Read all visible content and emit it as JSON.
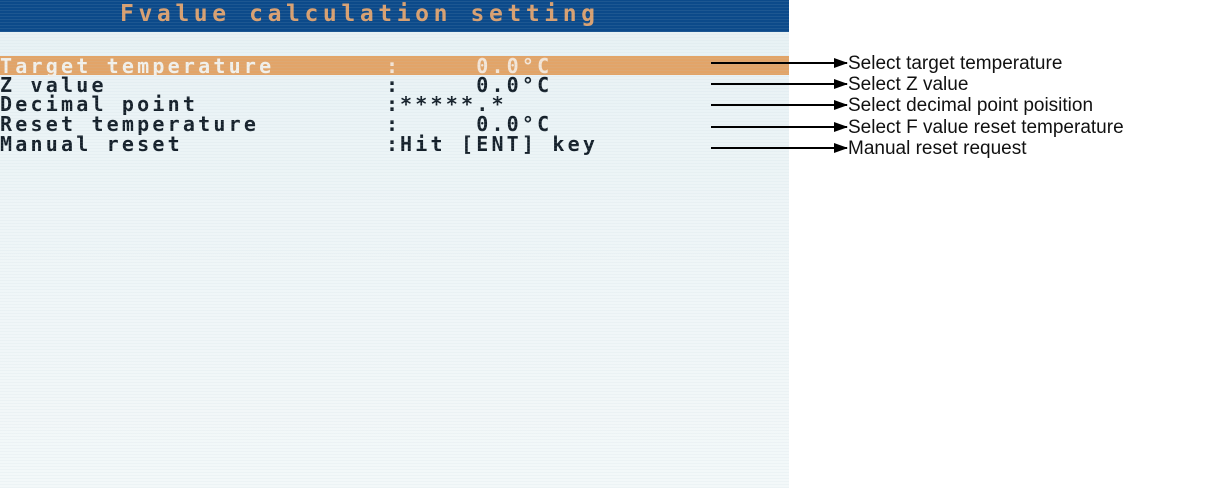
{
  "screen": {
    "title": "Fvalue calculation setting",
    "rows": [
      {
        "label": "Target temperature",
        "colon": ":",
        "value": "     0.0°C",
        "selected": true
      },
      {
        "label": "Z value",
        "colon": ":",
        "value": "     0.0°C",
        "selected": false
      },
      {
        "label": "Decimal point",
        "colon": ":",
        "value": "*****.*",
        "selected": false
      },
      {
        "label": "Reset temperature",
        "colon": ":",
        "value": "     0.0°C",
        "selected": false
      },
      {
        "label": "Manual reset",
        "colon": ":",
        "value": "Hit [ENT] key",
        "selected": false
      }
    ]
  },
  "annotations": [
    "Select target temperature",
    "Select Z value",
    "Select decimal point poisition",
    "Select F value reset temperature",
    "Manual reset request"
  ],
  "colors": {
    "title_bar": "#0c4a8a",
    "title_text": "#d9a070",
    "selected_row": "#e2a468",
    "screen_bg": "#e7f1f4",
    "text": "#15202a"
  }
}
